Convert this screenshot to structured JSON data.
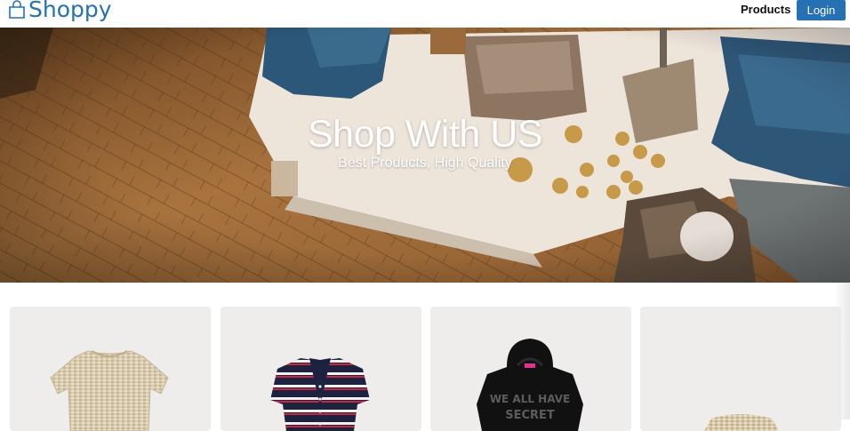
{
  "brand": {
    "name": "Shoppy",
    "icon": "shopping-bag-icon"
  },
  "nav": {
    "products_label": "Products",
    "login_label": "Login"
  },
  "hero": {
    "title": "Shop With US",
    "subtitle": "Best Products, High Quality"
  },
  "products": [
    {
      "image": "tweed-top-image",
      "print": ""
    },
    {
      "image": "striped-cardigan-image",
      "print": ""
    },
    {
      "image": "black-hoodie-image",
      "print": "WE ALL HAVE SECRET"
    },
    {
      "image": "tweed-skirt-image",
      "print": ""
    }
  ],
  "colors": {
    "brand": "#2670b5",
    "login_bg": "#2670b5",
    "card_bg": "#efedeb"
  }
}
